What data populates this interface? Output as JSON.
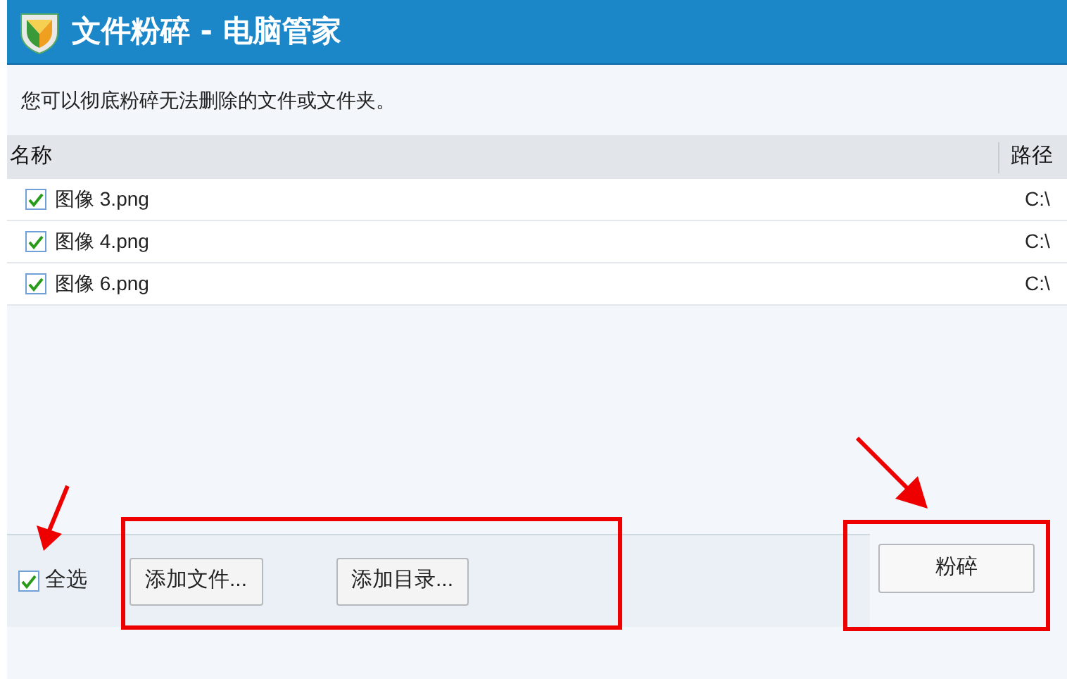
{
  "window": {
    "title": "文件粉碎 - 电脑管家"
  },
  "description": "您可以彻底粉碎无法删除的文件或文件夹。",
  "table": {
    "columns": [
      "名称",
      "路径"
    ],
    "rows": [
      {
        "name": "图像 3.png",
        "path": "C:\\",
        "checked": true
      },
      {
        "name": "图像 4.png",
        "path": "C:\\",
        "checked": true
      },
      {
        "name": "图像 6.png",
        "path": "C:\\",
        "checked": true
      }
    ]
  },
  "select_all": {
    "label": "全选",
    "checked": true
  },
  "buttons": [
    "添加文件...",
    "添加目录..."
  ],
  "shred_button": "粉碎"
}
